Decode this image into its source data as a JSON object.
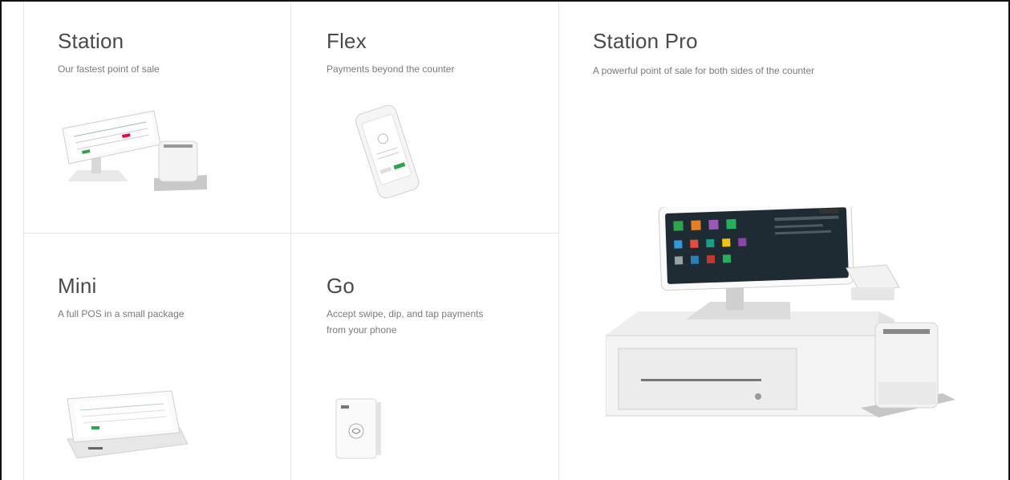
{
  "products": {
    "station": {
      "title": "Station",
      "subtitle": "Our fastest point of sale"
    },
    "flex": {
      "title": "Flex",
      "subtitle": "Payments beyond the counter"
    },
    "station_pro": {
      "title": "Station Pro",
      "subtitle": "A powerful point of sale for both sides of the counter"
    },
    "mini": {
      "title": "Mini",
      "subtitle": "A full POS in a small package"
    },
    "go": {
      "title": "Go",
      "subtitle_line1": "Accept swipe, dip, and tap payments",
      "subtitle_line2": "from your phone"
    }
  },
  "colors": {
    "border": "#e6e6e6",
    "device_body": "#f1f1f1",
    "screen": "#1f2b33",
    "accent_green": "#2ea44f"
  }
}
